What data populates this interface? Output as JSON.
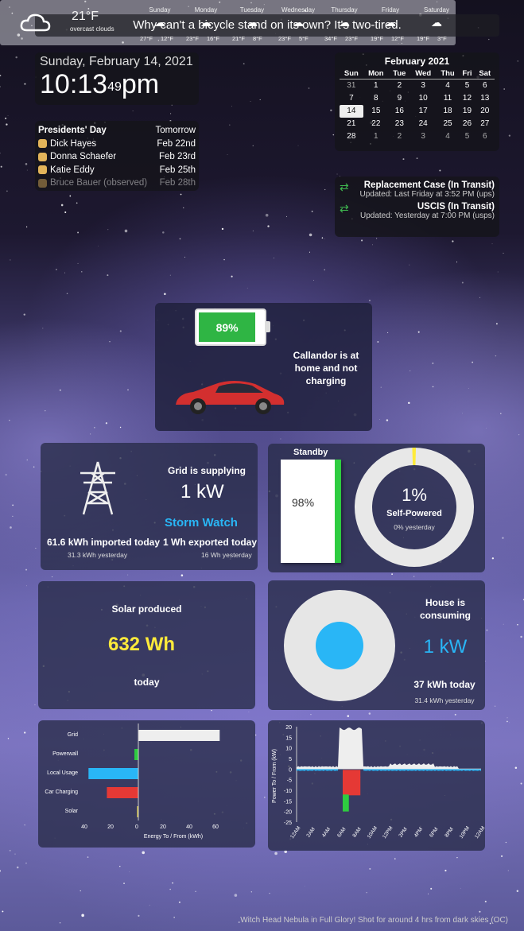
{
  "joke": "Why can't a bicycle stand on its own? It's two-tired.",
  "clock": {
    "date": "Sunday, February 14, 2021",
    "time": "10:13",
    "seconds": "49",
    "ampm": "pm"
  },
  "holidays": [
    {
      "name": "Presidents' Day",
      "date": "Tomorrow",
      "icon": false
    },
    {
      "name": "Dick Hayes",
      "date": "Feb 22nd",
      "icon": true
    },
    {
      "name": "Donna Schaefer",
      "date": "Feb 23rd",
      "icon": true
    },
    {
      "name": "Katie Eddy",
      "date": "Feb 25th",
      "icon": true
    },
    {
      "name": "Bruce Bauer (observed)",
      "date": "Feb 28th",
      "icon": true
    }
  ],
  "calendar": {
    "title": "February 2021",
    "days": [
      "Sun",
      "Mon",
      "Tue",
      "Wed",
      "Thu",
      "Fri",
      "Sat"
    ],
    "weeks": [
      [
        "31",
        "1",
        "2",
        "3",
        "4",
        "5",
        "6"
      ],
      [
        "7",
        "8",
        "9",
        "10",
        "11",
        "12",
        "13"
      ],
      [
        "14",
        "15",
        "16",
        "17",
        "18",
        "19",
        "20"
      ],
      [
        "21",
        "22",
        "23",
        "24",
        "25",
        "26",
        "27"
      ],
      [
        "28",
        "1",
        "2",
        "3",
        "4",
        "5",
        "6"
      ]
    ],
    "today": "14"
  },
  "packages": [
    {
      "title": "Replacement Case (In Transit)",
      "status": "Updated: Last Friday at 3:52 PM (ups)"
    },
    {
      "title": "USCIS (In Transit)",
      "status": "Updated: Yesterday at 7:00 PM (usps)"
    }
  ],
  "car": {
    "battery": "89%",
    "battery_fraction": 0.89,
    "message": "Callandor is at home and not charging",
    "color": "#d32f2f"
  },
  "grid": {
    "headline": "Grid is supplying",
    "value": "1 kW",
    "mode": "Storm Watch",
    "imported": "61.6 kWh imported today",
    "imported_y": "31.3 kWh yesterday",
    "exported": "1 Wh exported today",
    "exported_y": "16 Wh yesterday"
  },
  "powerwall": {
    "label": "Standby",
    "percent": "98%",
    "self_powered": "1%",
    "self_label": "Self-Powered",
    "self_y": "0% yesterday",
    "fill_fraction": 0.98
  },
  "solar": {
    "headline": "Solar produced",
    "value": "632 Wh",
    "sub": "today"
  },
  "house": {
    "headline": "House is consuming",
    "value": "1 kW",
    "today": "37 kWh today",
    "yesterday": "31.4 kWh yesterday"
  },
  "bar_chart": {
    "categories": [
      "Grid",
      "Powerwall",
      "Local Usage",
      "Car Charging",
      "Solar"
    ],
    "values": [
      62,
      -3,
      -38,
      -24,
      -0.6
    ],
    "xticks": [
      "40",
      "20",
      "0",
      "20",
      "40",
      "60"
    ],
    "xlabel": "Energy To / From (kWh)",
    "colors": [
      "#eeeeee",
      "#2ecc40",
      "#29b6f6",
      "#e53935",
      "#ffeb3b"
    ]
  },
  "line_chart": {
    "ylabel": "Power To / From (kW)",
    "yticks": [
      "20",
      "15",
      "10",
      "5",
      "0",
      "-5",
      "-10",
      "-15",
      "-20",
      "-25"
    ],
    "xticks": [
      "12AM",
      "2AM",
      "4AM",
      "6AM",
      "8AM",
      "10AM",
      "12PM",
      "2PM",
      "4PM",
      "6PM",
      "8PM",
      "10PM",
      "12AM"
    ]
  },
  "weather": {
    "current": "21°F",
    "desc": "overcast clouds",
    "days": [
      {
        "name": "Sunday",
        "hi": "27°F",
        "lo": "12°F"
      },
      {
        "name": "Monday",
        "hi": "23°F",
        "lo": "16°F"
      },
      {
        "name": "Tuesday",
        "hi": "21°F",
        "lo": "8°F"
      },
      {
        "name": "Wednesday",
        "hi": "23°F",
        "lo": "5°F"
      },
      {
        "name": "Thursday",
        "hi": "34°F",
        "lo": "23°F"
      },
      {
        "name": "Friday",
        "hi": "19°F",
        "lo": "12°F"
      },
      {
        "name": "Saturday",
        "hi": "19°F",
        "lo": "3°F"
      }
    ]
  },
  "credit": "Witch Head Nebula in Full Glory! Shot for around 4 hrs from dark skies (OC)"
}
